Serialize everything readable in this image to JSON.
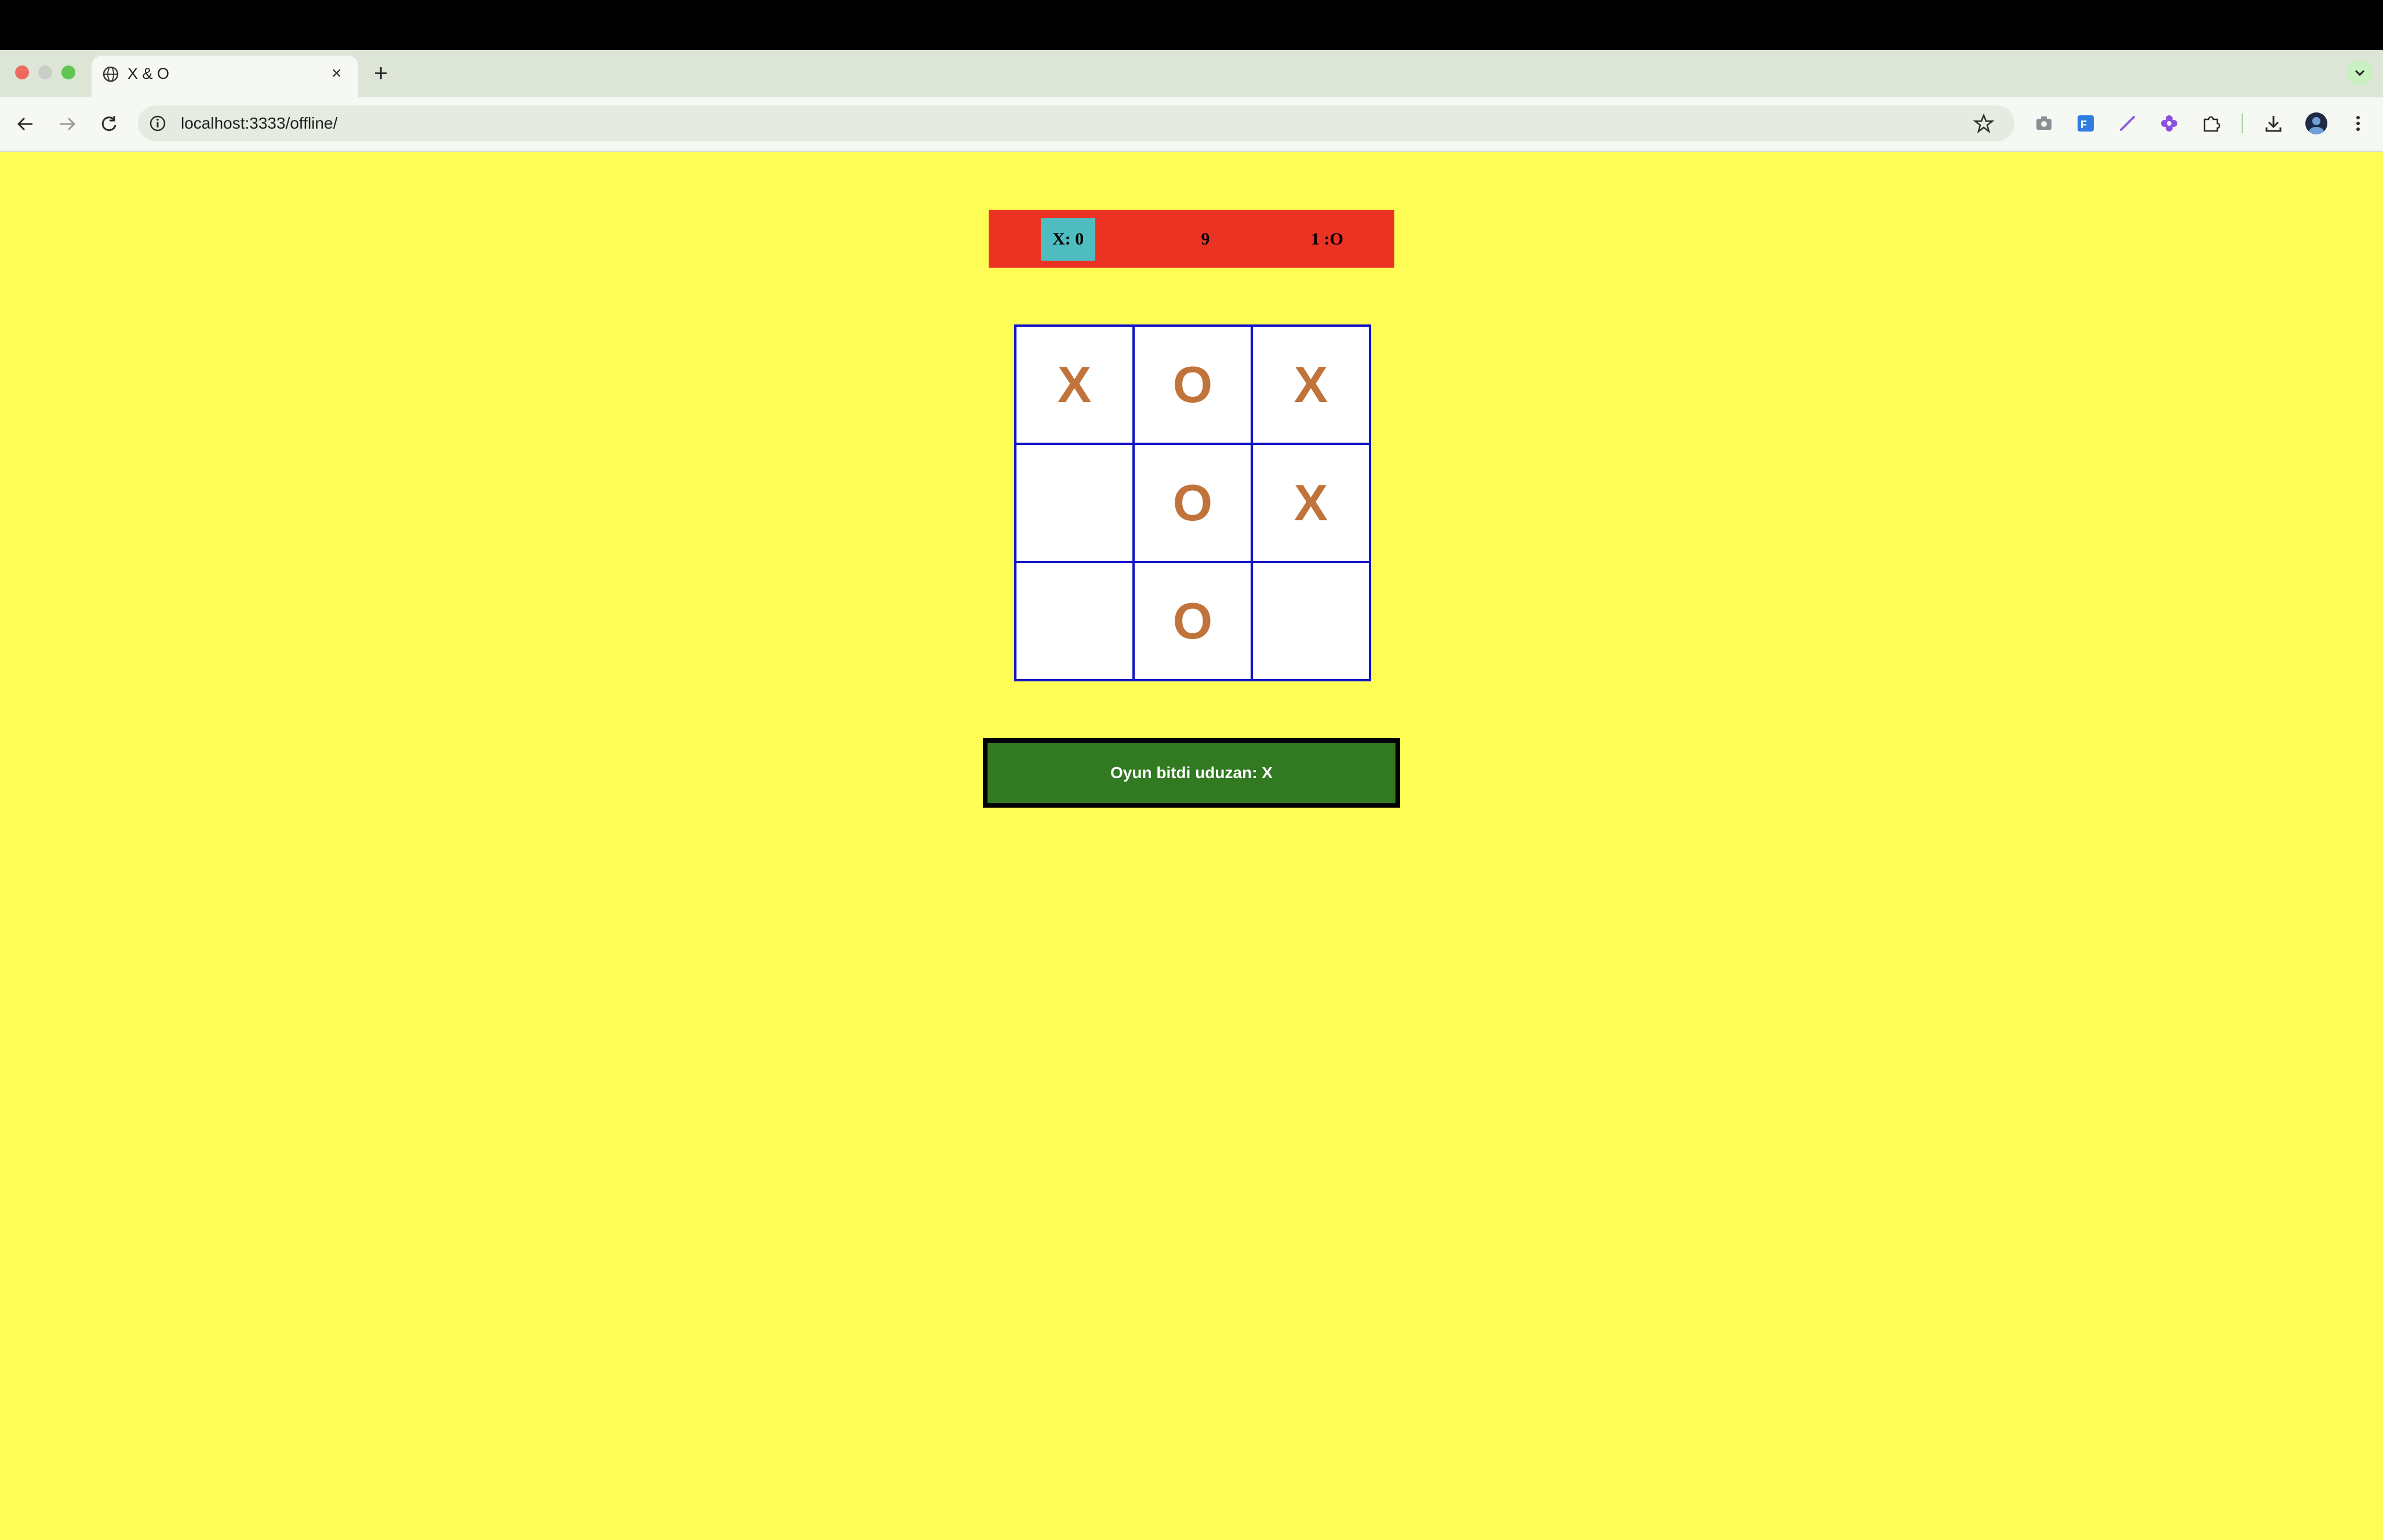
{
  "browser": {
    "tab_title": "X & O",
    "tab_close": "×",
    "new_tab": "+",
    "url": "localhost:3333/offline/",
    "icons": [
      "globe-icon",
      "close-icon",
      "plus-icon",
      "chevron-down-icon",
      "back-arrow-icon",
      "forward-arrow-icon",
      "reload-icon",
      "info-icon",
      "star-icon",
      "camera-icon",
      "translate-icon",
      "pen-icon",
      "flower-icon",
      "puzzle-icon",
      "download-icon",
      "avatar",
      "more-icon"
    ]
  },
  "scoreboard": {
    "x_score": "X: 0",
    "count": "9",
    "o_score": "1 :O"
  },
  "board": {
    "cells": [
      "X",
      "O",
      "X",
      "",
      "O",
      "X",
      "",
      "O",
      ""
    ]
  },
  "status": {
    "message": "Oyun bitdi uduzan: X"
  },
  "colors": {
    "page_background": "#fefe56",
    "scoreboard_background": "#eb3323",
    "x_score_background": "#4fbcbf",
    "cell_mark": "#c0733a",
    "grid_lines": "#1414c8",
    "status_background": "#317a22"
  }
}
